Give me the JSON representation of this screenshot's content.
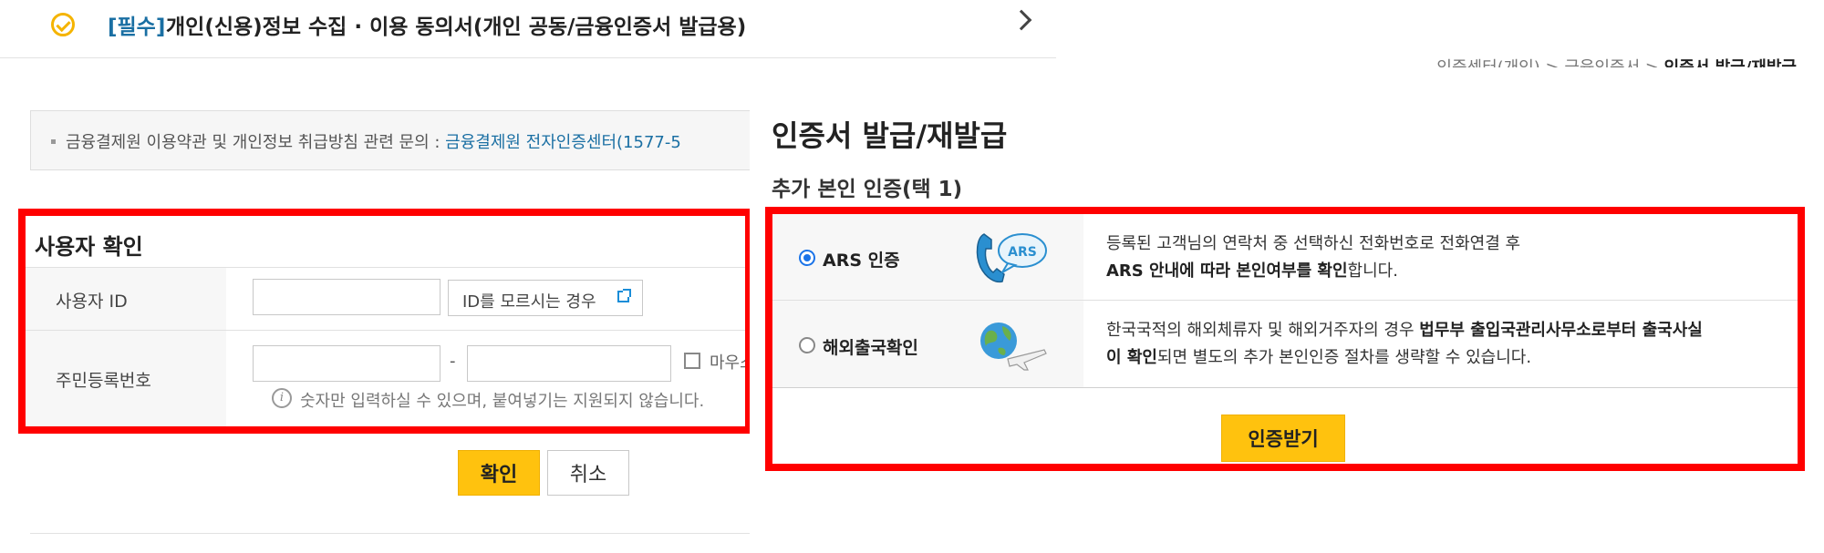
{
  "agreement": {
    "required_tag": "[필수]",
    "title": "개인(신용)정보 수집 · 이용 동의서(개인 공동/금융인증서 발급용)"
  },
  "notice": {
    "prefix": "금융결제원 이용약관 및 개인정보 취급방침 관련 문의 : ",
    "link": "금융결제원 전자인증센터(1577-5"
  },
  "user_check": {
    "heading": "사용자 확인",
    "id_label": "사용자 ID",
    "id_help_button": "ID를 모르시는 경우",
    "rrn_label": "주민등록번호",
    "rrn_dash": "-",
    "mouse_input_label": "마우스",
    "info_text": "숫자만 입력하실 수 있으며, 붙여넣기는 지원되지 않습니다.",
    "info_glyph": "i"
  },
  "buttons": {
    "confirm": "확인",
    "cancel": "취소",
    "get_auth": "인증받기"
  },
  "right_panel": {
    "breadcrumb_prefix": "인증센터(개인) > 금융인증서 > ",
    "breadcrumb_current": "인증서 발급/재발급",
    "page_title": "인증서 발급/재발급",
    "section_title": "추가 본인 인증(택 1)",
    "options": [
      {
        "label": "ARS 인증",
        "selected": true,
        "icon": "ars-phone-icon",
        "icon_text": "ARS",
        "desc_line1": "등록된 고객님의 연락처 중 선택하신 전화번호로 전화연결 후",
        "desc_line2_bold": "ARS 안내에 따라 본인여부를 확인",
        "desc_line2_rest": "합니다."
      },
      {
        "label": "해외출국확인",
        "selected": false,
        "icon": "globe-airplane-icon",
        "desc_part1": "한국국적의 해외체류자 및 해외거주자의 경우 ",
        "desc_bold1": "법무부 출입국관리사무소로부터 출국사실",
        "desc_bold2": "이 확인",
        "desc_part2": "되면 별도의 추가 본인인증 절차를 생략할 수 있습니다."
      }
    ]
  },
  "colors": {
    "highlight": "#ff0000",
    "accent_yellow": "#ffc20e",
    "link_blue": "#1a6fa3"
  }
}
